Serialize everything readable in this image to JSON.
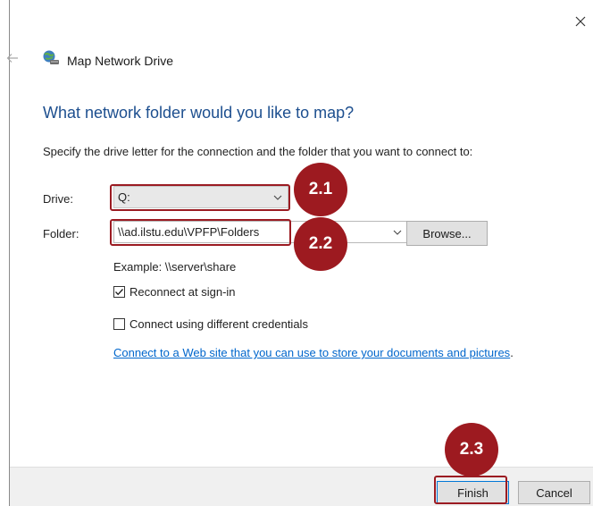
{
  "window": {
    "title": "Map Network Drive"
  },
  "main": {
    "heading": "What network folder would you like to map?",
    "instructions": "Specify the drive letter for the connection and the folder that you want to connect to:",
    "drive_label": "Drive:",
    "drive_value": "Q:",
    "folder_label": "Folder:",
    "folder_value": "\\\\ad.ilstu.edu\\VPFP\\Folders",
    "browse_label": "Browse...",
    "example_text": "Example: \\\\server\\share",
    "reconnect_label": "Reconnect at sign-in",
    "reconnect_checked": true,
    "credentials_label": "Connect using different credentials",
    "credentials_checked": false,
    "web_link": "Connect to a Web site that you can use to store your documents and pictures"
  },
  "link_suffix": ".",
  "footer": {
    "finish_label": "Finish",
    "cancel_label": "Cancel"
  },
  "annotations": {
    "step_1": "2.1",
    "step_2": "2.2",
    "step_3": "2.3",
    "color": "#9d1a20"
  },
  "colors": {
    "heading": "#1d4f8f",
    "link": "#0066cc",
    "footer_bg": "#f0f0f0"
  }
}
